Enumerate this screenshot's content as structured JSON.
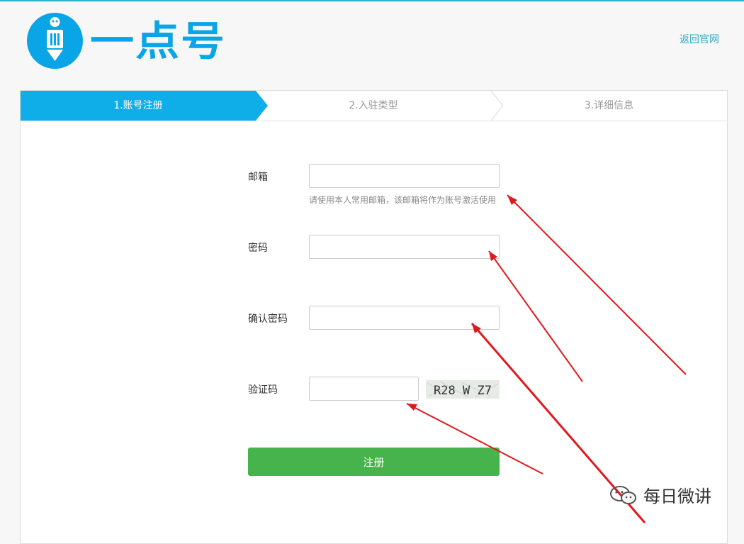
{
  "header": {
    "logo_text": "一点号",
    "back_link": "返回官网"
  },
  "steps": [
    {
      "label": "1.账号注册",
      "active": true
    },
    {
      "label": "2.入驻类型",
      "active": false
    },
    {
      "label": "3.详细信息",
      "active": false
    }
  ],
  "form": {
    "email_label": "邮箱",
    "email_value": "",
    "email_hint": "请使用本人常用邮箱，该邮箱将作为账号激活使用",
    "password_label": "密码",
    "password_value": "",
    "confirm_label": "确认密码",
    "confirm_value": "",
    "captcha_label": "验证码",
    "captcha_value": "",
    "captcha_image_text": "R28 W Z7",
    "submit_label": "注册"
  },
  "watermark": {
    "text": "每日微讲"
  },
  "colors": {
    "brand": "#09a5e6",
    "step_active": "#10aee8",
    "link": "#2aa8c5",
    "submit": "#47b34d",
    "arrow": "#e0191d"
  },
  "icons": [
    "logo-mascot-icon",
    "wechat-icon"
  ]
}
